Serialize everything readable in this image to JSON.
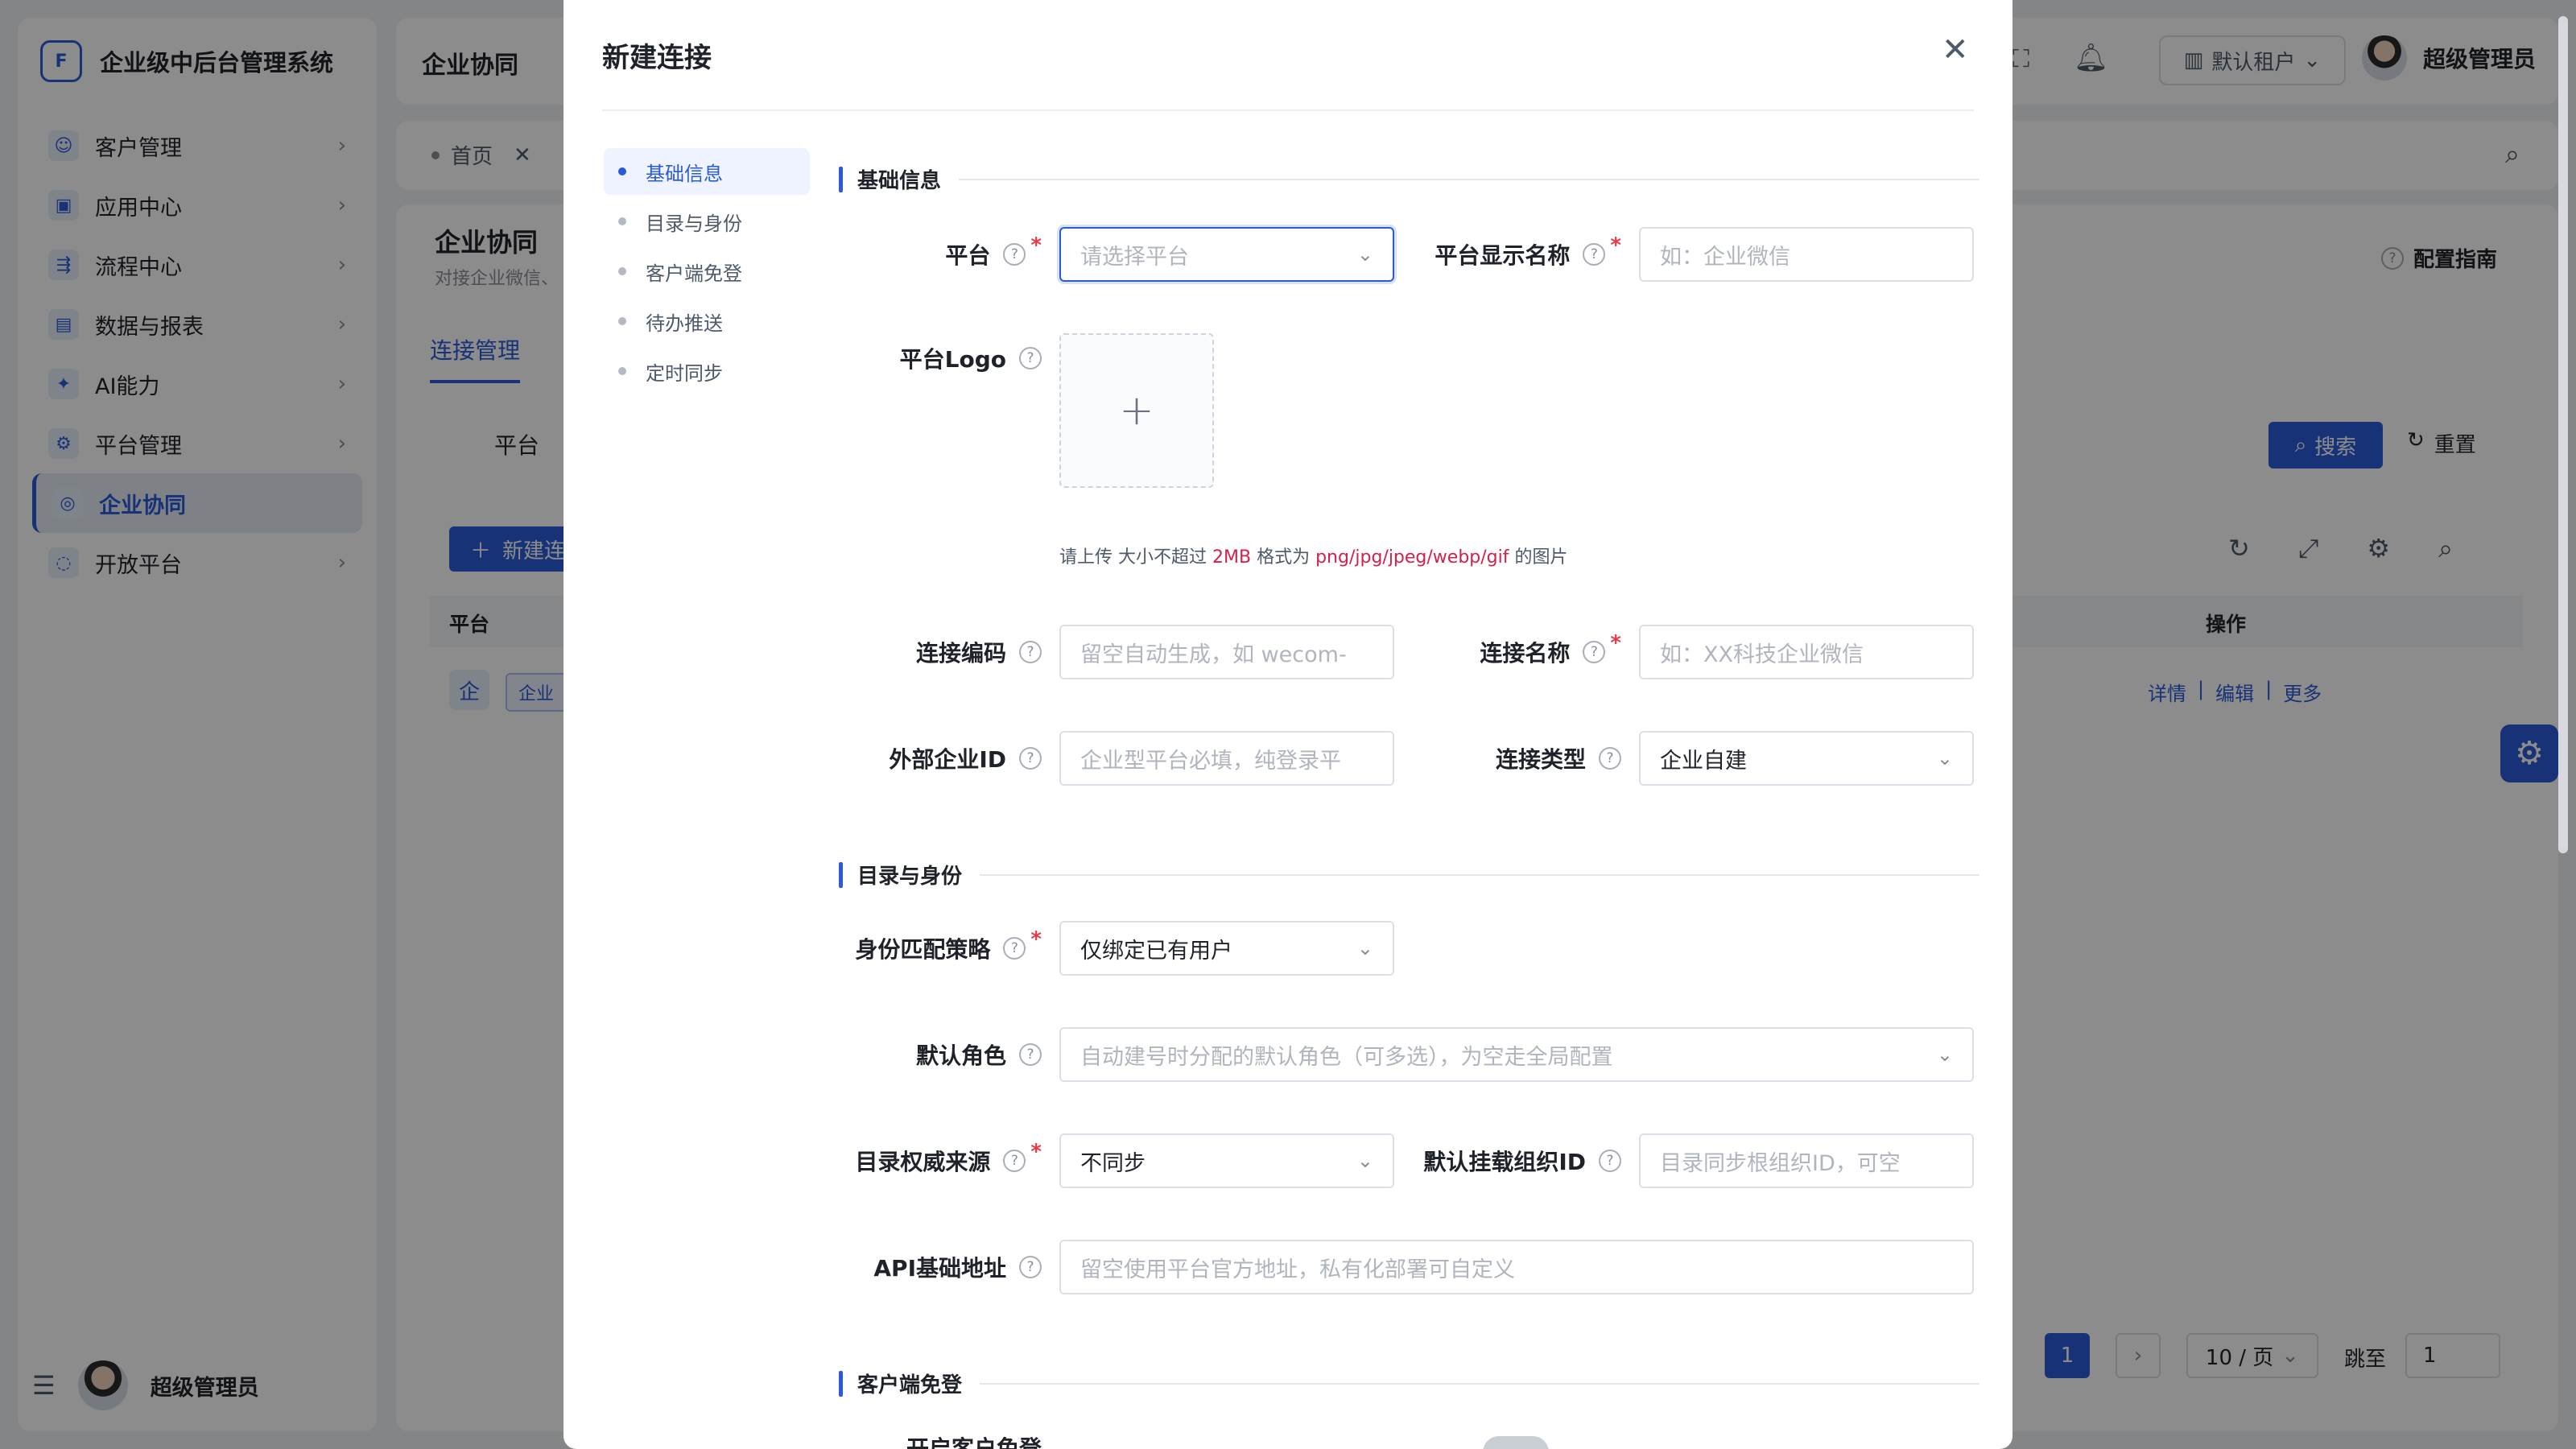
{
  "app": {
    "brand": "企业级中后台管理系统",
    "logo_text": "F",
    "topbar_title": "企业协同",
    "tenant_label": "默认租户",
    "user_name": "超级管理员"
  },
  "sidebar": {
    "items": [
      {
        "label": "客户管理",
        "icon": "person-icon"
      },
      {
        "label": "应用中心",
        "icon": "app-icon"
      },
      {
        "label": "流程中心",
        "icon": "flow-icon"
      },
      {
        "label": "数据与报表",
        "icon": "chart-icon"
      },
      {
        "label": "AI能力",
        "icon": "ai-icon"
      },
      {
        "label": "平台管理",
        "icon": "platform-icon"
      },
      {
        "label": "企业协同",
        "icon": "collab-icon"
      },
      {
        "label": "开放平台",
        "icon": "open-icon"
      }
    ],
    "user_name": "超级管理员"
  },
  "background_page": {
    "tab_home": "首页",
    "page_title": "企业协同",
    "page_desc": "对接企业微信、",
    "config_guide": "配置指南",
    "tab_connections": "连接管理",
    "filter_platform": "平台",
    "search_btn": "搜索",
    "reset_btn": "重置",
    "new_btn": "新建连",
    "col_platform": "平台",
    "col_actions": "操作",
    "row_badge": "企",
    "row_tag": "企业",
    "row_actions": [
      "详情",
      "编辑",
      "更多"
    ],
    "pager_current": "1",
    "pager_size": "10 / 页",
    "pager_goto": "跳至",
    "pager_goto_value": "1"
  },
  "modal": {
    "title": "新建连接",
    "anchors": [
      "基础信息",
      "目录与身份",
      "客户端免登",
      "待办推送",
      "定时同步"
    ],
    "sections": {
      "basic": "基础信息",
      "directory": "目录与身份",
      "sso": "客户端免登"
    },
    "fields": {
      "platform": {
        "label": "平台",
        "placeholder": "请选择平台"
      },
      "display_name": {
        "label": "平台显示名称",
        "placeholder": "如：企业微信"
      },
      "logo": {
        "label": "平台Logo"
      },
      "upload_hint_prefix": "请上传 大小不超过 ",
      "upload_hint_size": "2MB",
      "upload_hint_mid": " 格式为 ",
      "upload_hint_formats": "png/jpg/jpeg/webp/gif",
      "upload_hint_suffix": " 的图片",
      "code": {
        "label": "连接编码",
        "placeholder": "留空自动生成，如 wecom-"
      },
      "name": {
        "label": "连接名称",
        "placeholder": "如：XX科技企业微信"
      },
      "corp_id": {
        "label": "外部企业ID",
        "placeholder": "企业型平台必填，纯登录平"
      },
      "conn_type": {
        "label": "连接类型",
        "value": "企业自建"
      },
      "identity_policy": {
        "label": "身份匹配策略",
        "value": "仅绑定已有用户"
      },
      "default_role": {
        "label": "默认角色",
        "placeholder": "自动建号时分配的默认角色（可多选），为空走全局配置"
      },
      "dir_source": {
        "label": "目录权威来源",
        "value": "不同步"
      },
      "mount_org": {
        "label": "默认挂载组织ID",
        "placeholder": "目录同步根组织ID，可空"
      },
      "api_base": {
        "label": "API基础地址",
        "placeholder": "留空使用平台官方地址，私有化部署可自定义"
      },
      "sso_partial": {
        "label": "开启客户免登"
      }
    }
  }
}
